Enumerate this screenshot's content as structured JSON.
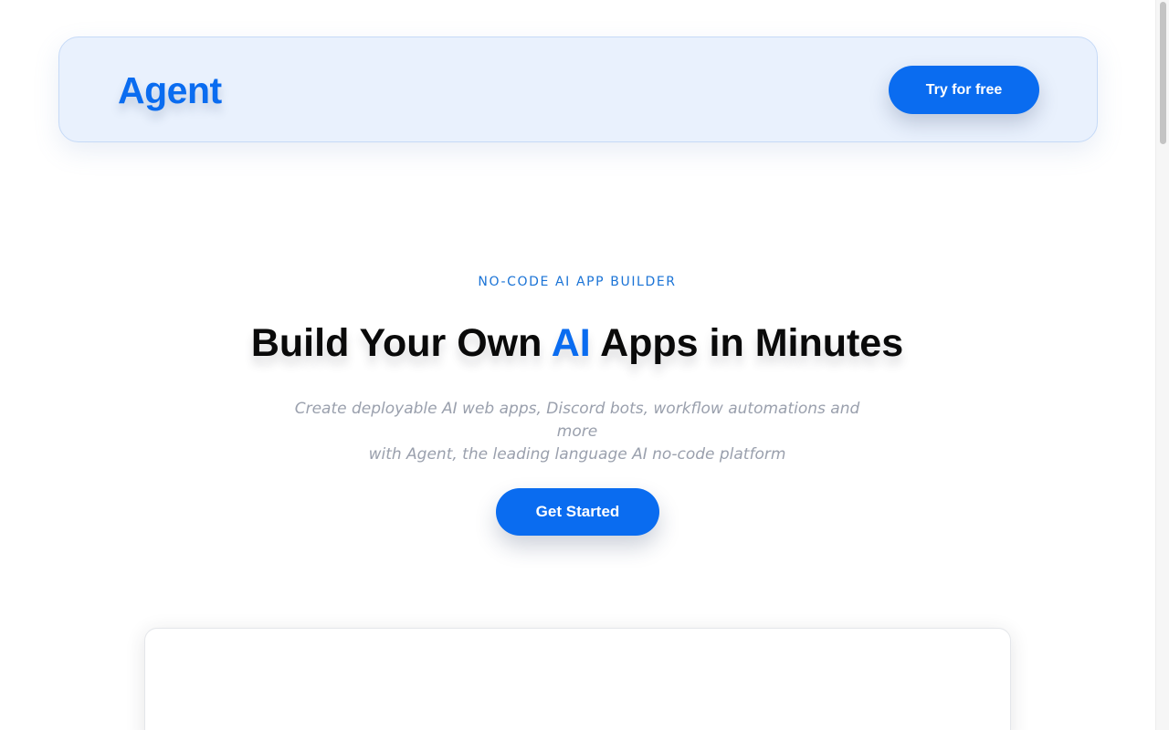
{
  "header": {
    "logo_text": "Agent",
    "cta_label": "Try for free"
  },
  "hero": {
    "eyebrow": "NO-CODE AI APP BUILDER",
    "headline_before": "Build Your Own ",
    "headline_accent": "AI",
    "headline_after": " Apps in Minutes",
    "subtitle_line1": "Create deployable AI web apps, Discord bots, workflow automations and more",
    "subtitle_line2": "with Agent, the leading language AI no-code platform",
    "cta_label": "Get Started"
  },
  "colors": {
    "accent": "#0a6cf0",
    "header_bg": "#e9f1fd",
    "eyebrow": "#1a73d6",
    "subtitle": "#9aa0ad",
    "headline": "#0a0a0a"
  }
}
